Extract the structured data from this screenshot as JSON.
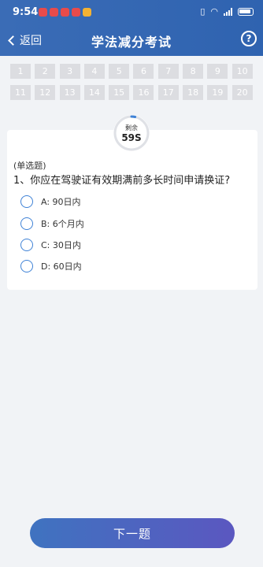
{
  "status_bar": {
    "time": "9:54",
    "notification_colors": [
      "#e84b4b",
      "#e84b4b",
      "#e84b4b",
      "#e84b4b",
      "#f3b233"
    ]
  },
  "header": {
    "back_label": "返回",
    "title": "学法减分考试",
    "help_icon": "?"
  },
  "question_grid": [
    "1",
    "2",
    "3",
    "4",
    "5",
    "6",
    "7",
    "8",
    "9",
    "10",
    "11",
    "12",
    "13",
    "14",
    "15",
    "16",
    "17",
    "18",
    "19",
    "20"
  ],
  "timer": {
    "label": "剩余",
    "value": "59S",
    "remaining_fraction": 0.98
  },
  "question": {
    "type": "(单选题)",
    "text": "1、你应在驾驶证有效期满前多长时间申请换证?",
    "options": [
      {
        "label": "A:  90日内"
      },
      {
        "label": "B:  6个月内"
      },
      {
        "label": "C:  30日内"
      },
      {
        "label": "D:  60日内"
      }
    ]
  },
  "next_button": "下一题",
  "colors": {
    "header": "#2f63b0",
    "accent": "#3f82d6",
    "button_start": "#3f73c0",
    "button_end": "#5b57c0"
  }
}
